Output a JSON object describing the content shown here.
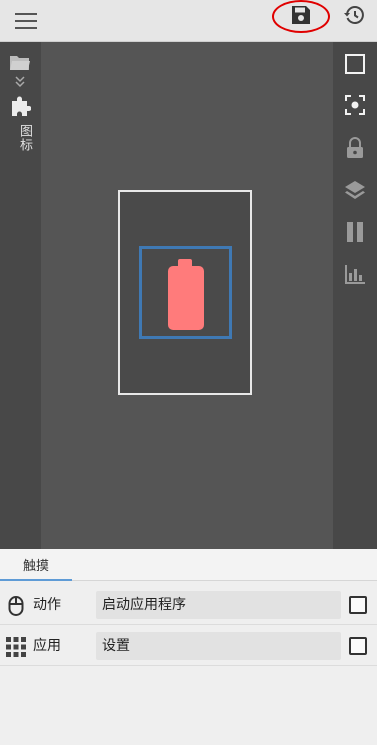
{
  "toolbar": {
    "menu_icon": "hamburger-menu-icon",
    "save_icon": "floppy-disk-icon",
    "history_icon": "history-clock-icon",
    "highlight_color": "#e00000"
  },
  "left_rail": {
    "folder_icon": "folder-icon",
    "collapse_icon": "double-chevron-down-icon",
    "puzzle_icon": "puzzle-piece-icon",
    "label": "图标"
  },
  "right_rail": {
    "icons": [
      "square-outline-icon",
      "focus-frame-icon",
      "lock-icon",
      "layers-icon",
      "pause-icon",
      "bar-chart-icon"
    ]
  },
  "canvas": {
    "selection_color": "#3f79b4",
    "battery_color": "#ff7b7b",
    "widget_icon": "battery-icon"
  },
  "panel": {
    "tab_label": "触摸",
    "rows": [
      {
        "icon": "mouse-icon",
        "label": "动作",
        "value": "启动应用程序",
        "checked": false
      },
      {
        "icon": "app-grid-icon",
        "label": "应用",
        "value": "设置",
        "checked": false
      }
    ]
  }
}
